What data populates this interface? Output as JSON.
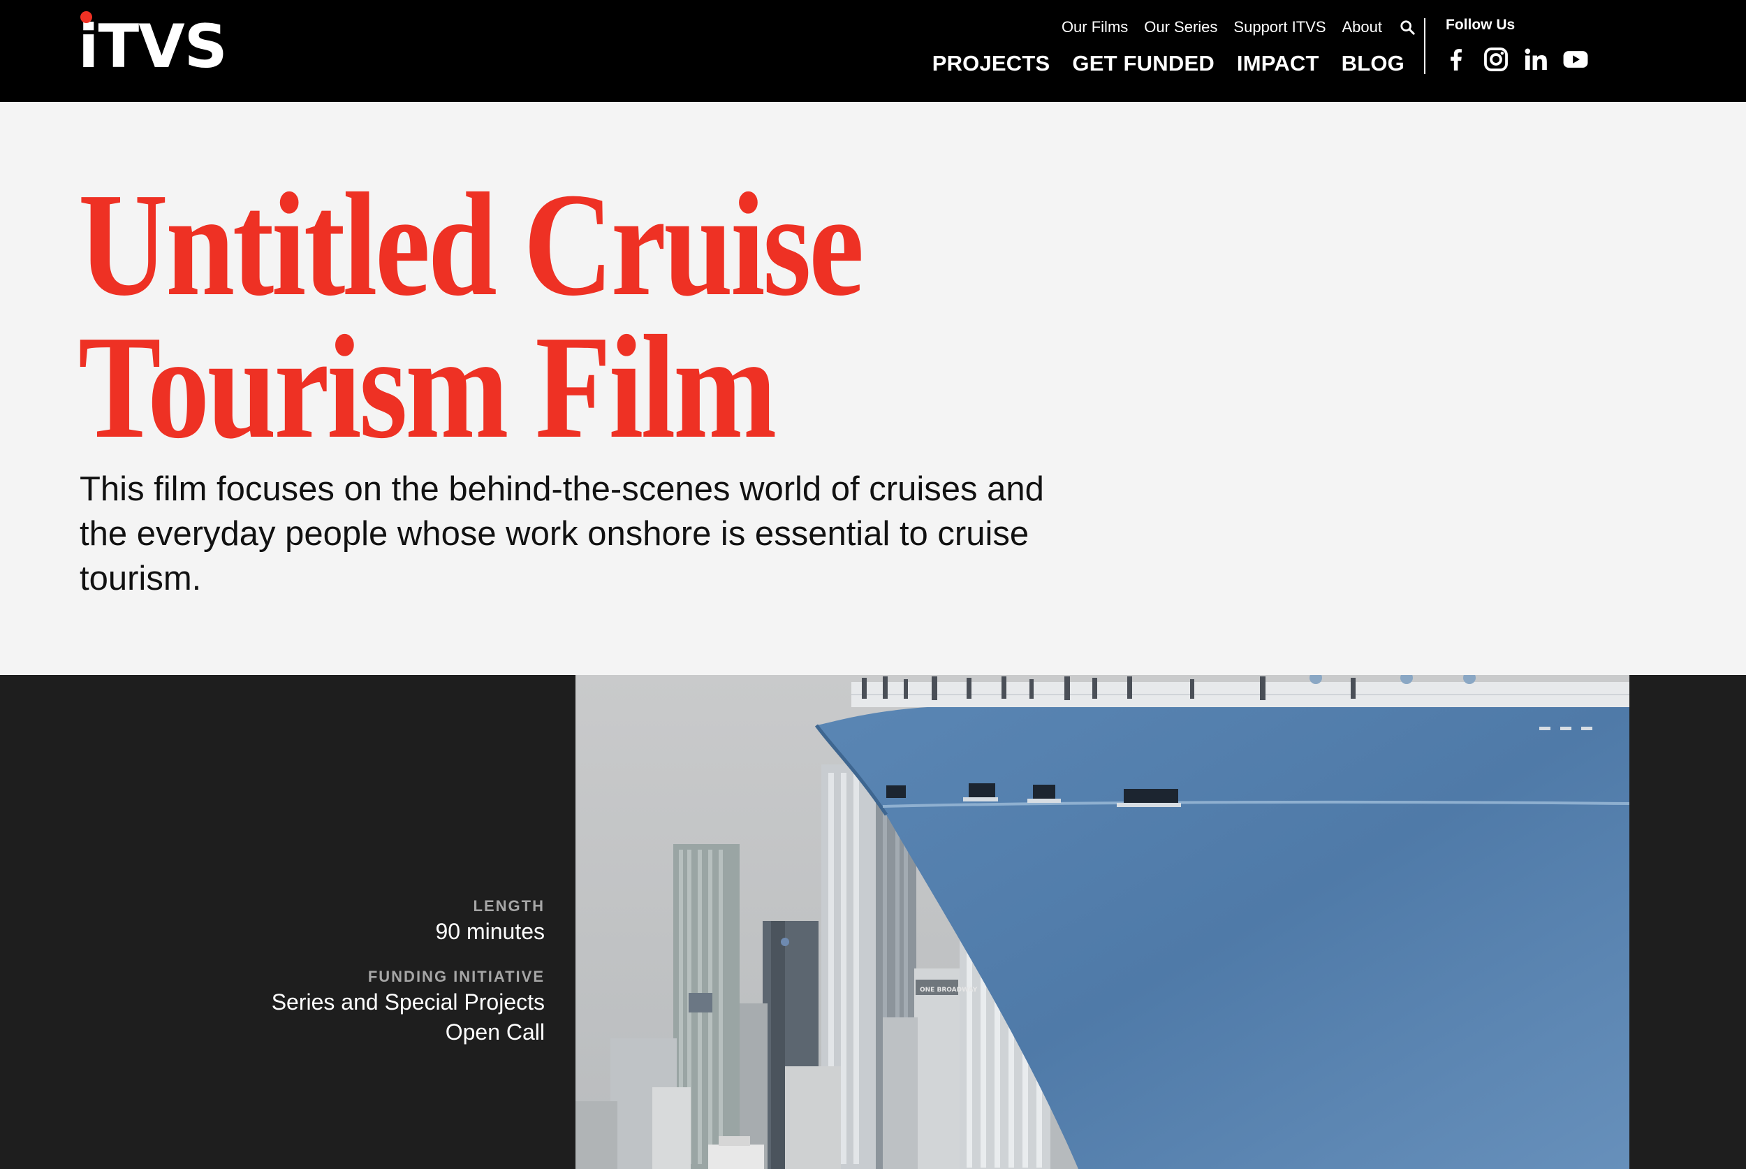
{
  "brand": {
    "logo_text": "iTVS",
    "accent": "#ee3124",
    "header_bg": "#000000",
    "band_bg": "#1e1e1e",
    "page_bg": "#f4f4f4"
  },
  "utility_nav": [
    "Our Films",
    "Our Series",
    "Support ITVS",
    "About"
  ],
  "main_nav": [
    "PROJECTS",
    "GET FUNDED",
    "IMPACT",
    "BLOG"
  ],
  "follow": {
    "label": "Follow Us",
    "icons": [
      "facebook-icon",
      "instagram-icon",
      "linkedin-icon",
      "youtube-icon"
    ]
  },
  "hero": {
    "title": "Untitled Cruise Tourism Film",
    "description": "This film focuses on the behind-the-scenes world of cruises and the everyday people whose work onshore is essential to cruise tourism."
  },
  "details": {
    "length_label": "LENGTH",
    "length_value": "90 minutes",
    "funding_label": "FUNDING INITIATIVE",
    "funding_value_line1": "Series and Special Projects",
    "funding_value_line2": "Open Call"
  },
  "image": {
    "subject": "cruise ship bow passing city skyline",
    "sign_text": "ONE BROADWAY"
  }
}
